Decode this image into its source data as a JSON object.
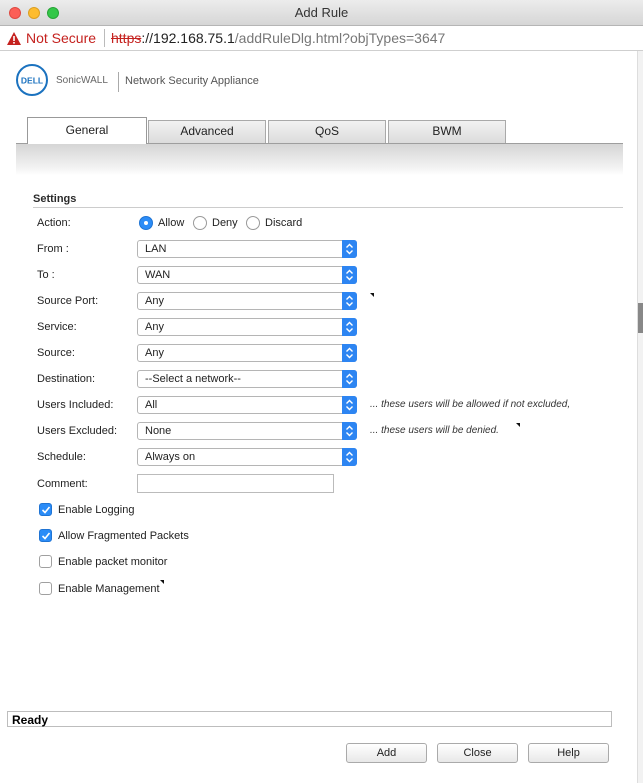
{
  "window": {
    "title": "Add Rule"
  },
  "addressbar": {
    "security_label": "Not Secure",
    "url_scheme": "https",
    "url_host": "://192.168.75.1",
    "url_path": "/addRuleDlg.html?objTypes=3647"
  },
  "header": {
    "logo_text": "DELL",
    "brand": "SonicWALL",
    "appliance": "Network Security Appliance"
  },
  "tabs": [
    {
      "label": "General",
      "active": true
    },
    {
      "label": "Advanced",
      "active": false
    },
    {
      "label": "QoS",
      "active": false
    },
    {
      "label": "BWM",
      "active": false
    }
  ],
  "settings": {
    "title": "Settings",
    "action": {
      "label": "Action:",
      "options": [
        "Allow",
        "Deny",
        "Discard"
      ],
      "selected": "Allow"
    },
    "fields": [
      {
        "label": "From :",
        "value": "LAN"
      },
      {
        "label": "To :",
        "value": "WAN"
      },
      {
        "label": "Source Port:",
        "value": "Any"
      },
      {
        "label": "Service:",
        "value": "Any"
      },
      {
        "label": "Source:",
        "value": "Any"
      },
      {
        "label": "Destination:",
        "value": "--Select a network--"
      },
      {
        "label": "Users Included:",
        "value": "All",
        "hint": "... these users will be allowed if not excluded,"
      },
      {
        "label": "Users Excluded:",
        "value": "None",
        "hint": "... these users will be denied."
      },
      {
        "label": "Schedule:",
        "value": "Always on"
      }
    ],
    "comment_label": "Comment:",
    "comment_value": "",
    "checkboxes": [
      {
        "label": "Enable Logging",
        "checked": true
      },
      {
        "label": "Allow Fragmented Packets",
        "checked": true
      },
      {
        "label": "Enable packet monitor",
        "checked": false
      },
      {
        "label": "Enable Management",
        "checked": false
      }
    ]
  },
  "status": {
    "text": "Ready"
  },
  "footer": {
    "add_label": "Add",
    "close_label": "Close",
    "help_label": "Help"
  },
  "colors": {
    "accent": "#2b8cf7",
    "warning": "#c5221f"
  }
}
